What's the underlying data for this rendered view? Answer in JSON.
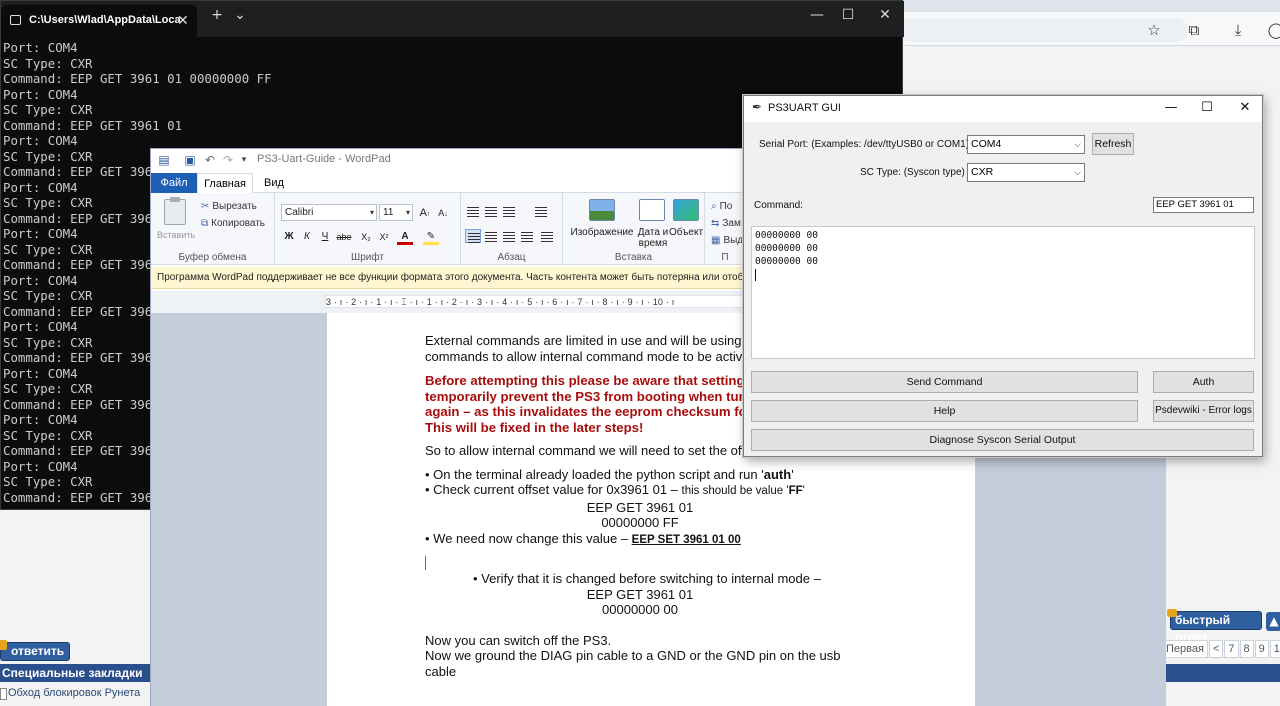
{
  "terminal": {
    "tab_title": "C:\\Users\\Wlad\\AppData\\Loca",
    "tab_close": "✕",
    "new_tab": "+",
    "dropdown": "⌄",
    "minimize": "—",
    "maximize": "☐",
    "close": "✕",
    "lines": [
      "Port: COM4",
      "SC Type: CXR",
      "Command: EEP GET 3961 01 00000000 FF",
      "Port: COM4",
      "SC Type: CXR",
      "Command: EEP GET 3961 01",
      "Port: COM4",
      "SC Type: CXR",
      "Command: EEP GET 396",
      "Port: COM4",
      "SC Type: CXR",
      "Command: EEP GET 396",
      "Port: COM4",
      "SC Type: CXR",
      "Command: EEP GET 396",
      "Port: COM4",
      "SC Type: CXR",
      "Command: EEP GET 396",
      "Port: COM4",
      "SC Type: CXR",
      "Command: EEP GET 396",
      "Port: COM4",
      "SC Type: CXR",
      "Command: EEP GET 396",
      "Port: COM4",
      "SC Type: CXR",
      "Command: EEP GET 396",
      "Port: COM4",
      "SC Type: CXR",
      "Command: EEP GET 396"
    ]
  },
  "wordpad": {
    "title": "PS3-Uart-Guide - WordPad",
    "tabs": {
      "file": "Файл",
      "home": "Главная",
      "view": "Вид"
    },
    "clipboard": {
      "paste": "Вставить",
      "cut": "Вырезать",
      "copy": "Копировать",
      "group": "Буфер обмена"
    },
    "font": {
      "family": "Calibri",
      "size": "11",
      "group": "Шрифт",
      "bold": "Ж",
      "italic": "К",
      "underline": "Ч",
      "strike": "abe"
    },
    "paragraph": {
      "group": "Абзац"
    },
    "insert": {
      "image": "Изображение",
      "datetime": "Дата и время",
      "object": "Объект",
      "group": "Вставка"
    },
    "edit": {
      "find": "По",
      "replace": "Зам",
      "select": "Выд",
      "group": "П"
    },
    "infobar": "Программа WordPad поддерживает не все функции формата этого документа. Часть контента может быть потеряна или отображ",
    "ruler": "3 · ı · 2 · ı · 1 · ı · ⌶ · ı · 1 · ı · 2 · ı · 3 · ı · 4 · ı · 5 · ı · 6 · ı · 7 · ı · 8 · ı · 9 · ı · 10 · ı",
    "doc": {
      "p1a": "External commands are limited in use and will be using",
      "p1b": "commands to allow internal command mode to be activ",
      "w1": "Before attempting this please be aware that setting",
      "w2": "temporarily prevent the PS3 from booting when turn",
      "w3": "again – as this invalidates the eeprom checksum fo",
      "w4": "This will be fixed in the later steps!",
      "p2": "So to allow internal command we will need to set the offset:",
      "b1_pre": "• On the terminal already loaded the python script and run '",
      "b1_bold": "auth",
      "b1_post": "'",
      "b2_pre": "• Check current offset value for 0x3961 01 – ",
      "b2_small": "this should be value '",
      "b2_bold": "FF",
      "b2_end": "'",
      "c1": "EEP GET 3961 01",
      "c2": "00000000 FF",
      "b3_pre": "• We need now change this value – ",
      "b3_u": "EEP SET 3961 01 00",
      "b4": "• Verify that it is changed before switching to internal mode –",
      "c3": "EEP GET 3961 01",
      "c4": "00000000 00",
      "p3": "Now you can switch off the PS3.",
      "p4a": "Now we ground the DIAG pin cable to a GND or the GND pin on the usb",
      "p4b": "cable"
    }
  },
  "gui": {
    "title": "PS3UART GUI",
    "minimize": "—",
    "maximize": "☐",
    "close": "✕",
    "serial_label": "Serial Port: (Examples: /dev/ttyUSB0 or COM1)",
    "serial_value": "COM4",
    "refresh": "Refresh",
    "sc_label": "SC Type: (Syscon type)",
    "sc_value": "CXR",
    "command_label": "Command:",
    "command_value": "EEP GET 3961 01",
    "output_lines": [
      "00000000  00",
      "00000000  00",
      "00000000  00"
    ],
    "send": "Send Command",
    "auth": "Auth",
    "help": "Help",
    "errorlogs": "Psdevwiki - Error logs",
    "diagnose": "Diagnose Syscon Serial Output"
  },
  "browser": {
    "reply": "ответить",
    "bookmarks": "Специальные закладки",
    "bypass": "Обход блокировок Рунета",
    "quick_reply": "быстрый ответ",
    "up": "▲",
    "pager": [
      "Первая",
      "<",
      "7",
      "8",
      "9",
      "10"
    ],
    "star": "☆",
    "ext": "⧉",
    "download": "⤓",
    "profile": "◯"
  }
}
